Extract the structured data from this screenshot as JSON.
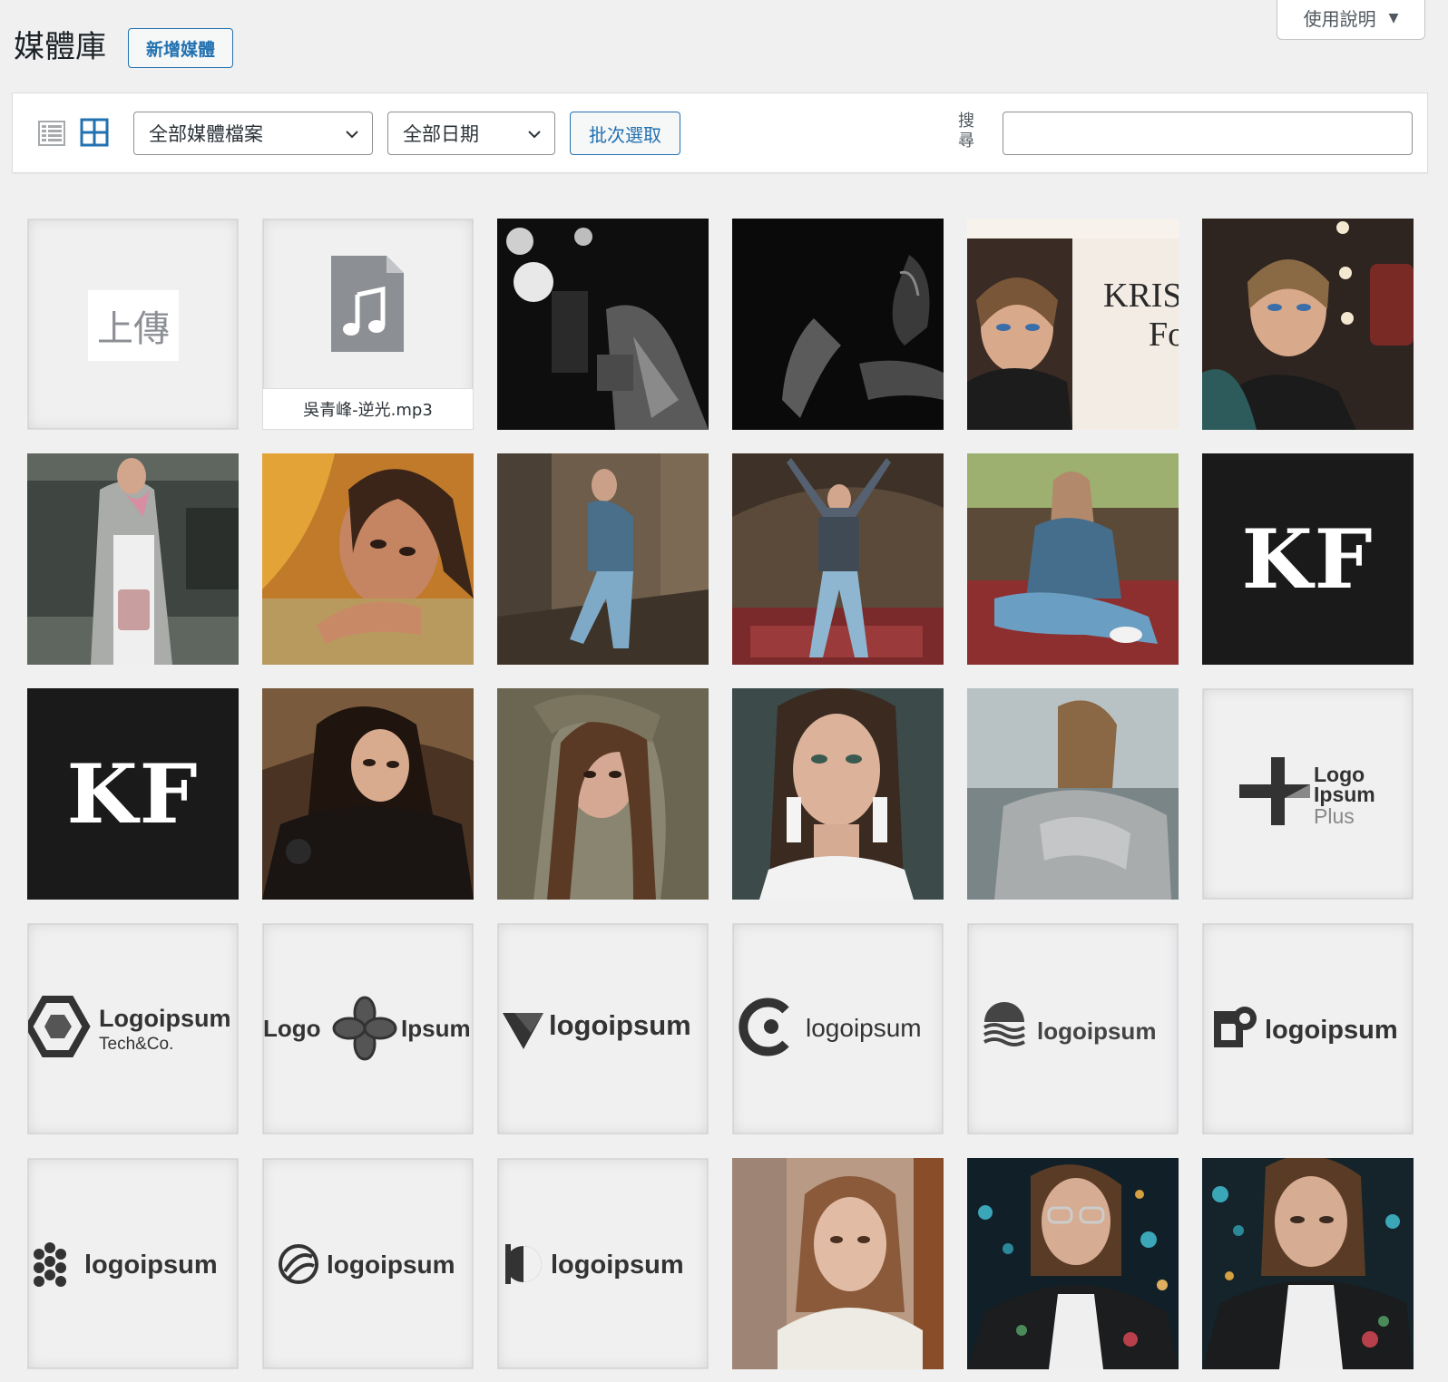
{
  "help_tab": {
    "label": "使用說明"
  },
  "header": {
    "title": "媒體庫",
    "add_new_label": "新增媒體"
  },
  "toolbar": {
    "type_filter": "全部媒體檔案",
    "date_filter": "全部日期",
    "bulk_select_label": "批次選取",
    "search_label": "搜尋",
    "search_value": ""
  },
  "grid": {
    "upload_label": "上傳",
    "audio_filename": "吳青峰-逆光.mp3",
    "kf_text": "KF",
    "kris_text": "KRIS",
    "kris_text2": "Fo",
    "logos": {
      "plus": [
        "Logo",
        "Ipsum",
        "Plus"
      ],
      "techco": [
        "Logoipsum",
        "Tech&Co."
      ],
      "flower": [
        "Logo",
        "Ipsum"
      ],
      "generic": "logoipsum"
    }
  }
}
